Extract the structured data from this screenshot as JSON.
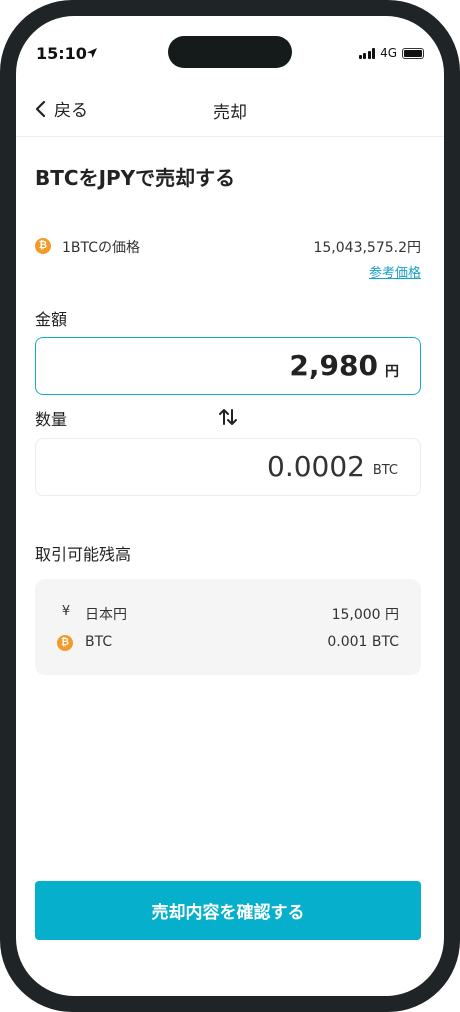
{
  "status_bar": {
    "time": "15:10",
    "network": "4G",
    "icons": [
      "location-arrow-icon",
      "signal-icon",
      "battery-icon"
    ]
  },
  "nav": {
    "back_label": "戻る",
    "title": "売却"
  },
  "heading": "BTCをJPYで売却する",
  "price": {
    "icon": "bitcoin-icon",
    "label": "1BTCの価格",
    "value": "15,043,575.2円",
    "reference_link": "参考価格"
  },
  "amount": {
    "label": "金額",
    "value": "2,980",
    "unit": "円"
  },
  "quantity": {
    "label": "数量",
    "value": "0.0002",
    "unit": "BTC",
    "swap_icon": "swap-vertical-icon"
  },
  "balance": {
    "title": "取引可能残高",
    "rows": [
      {
        "icon": "yen-icon",
        "symbol": "¥",
        "name": "日本円",
        "amount": "15,000 円"
      },
      {
        "icon": "bitcoin-icon",
        "name": "BTC",
        "amount": "0.001 BTC"
      }
    ]
  },
  "confirm_button": "売却内容を確認する",
  "colors": {
    "accent": "#06afcc",
    "input_border": "#18a8cc",
    "link": "#16a3c9",
    "bitcoin": "#f39a2b",
    "frame": "#1f2526"
  }
}
